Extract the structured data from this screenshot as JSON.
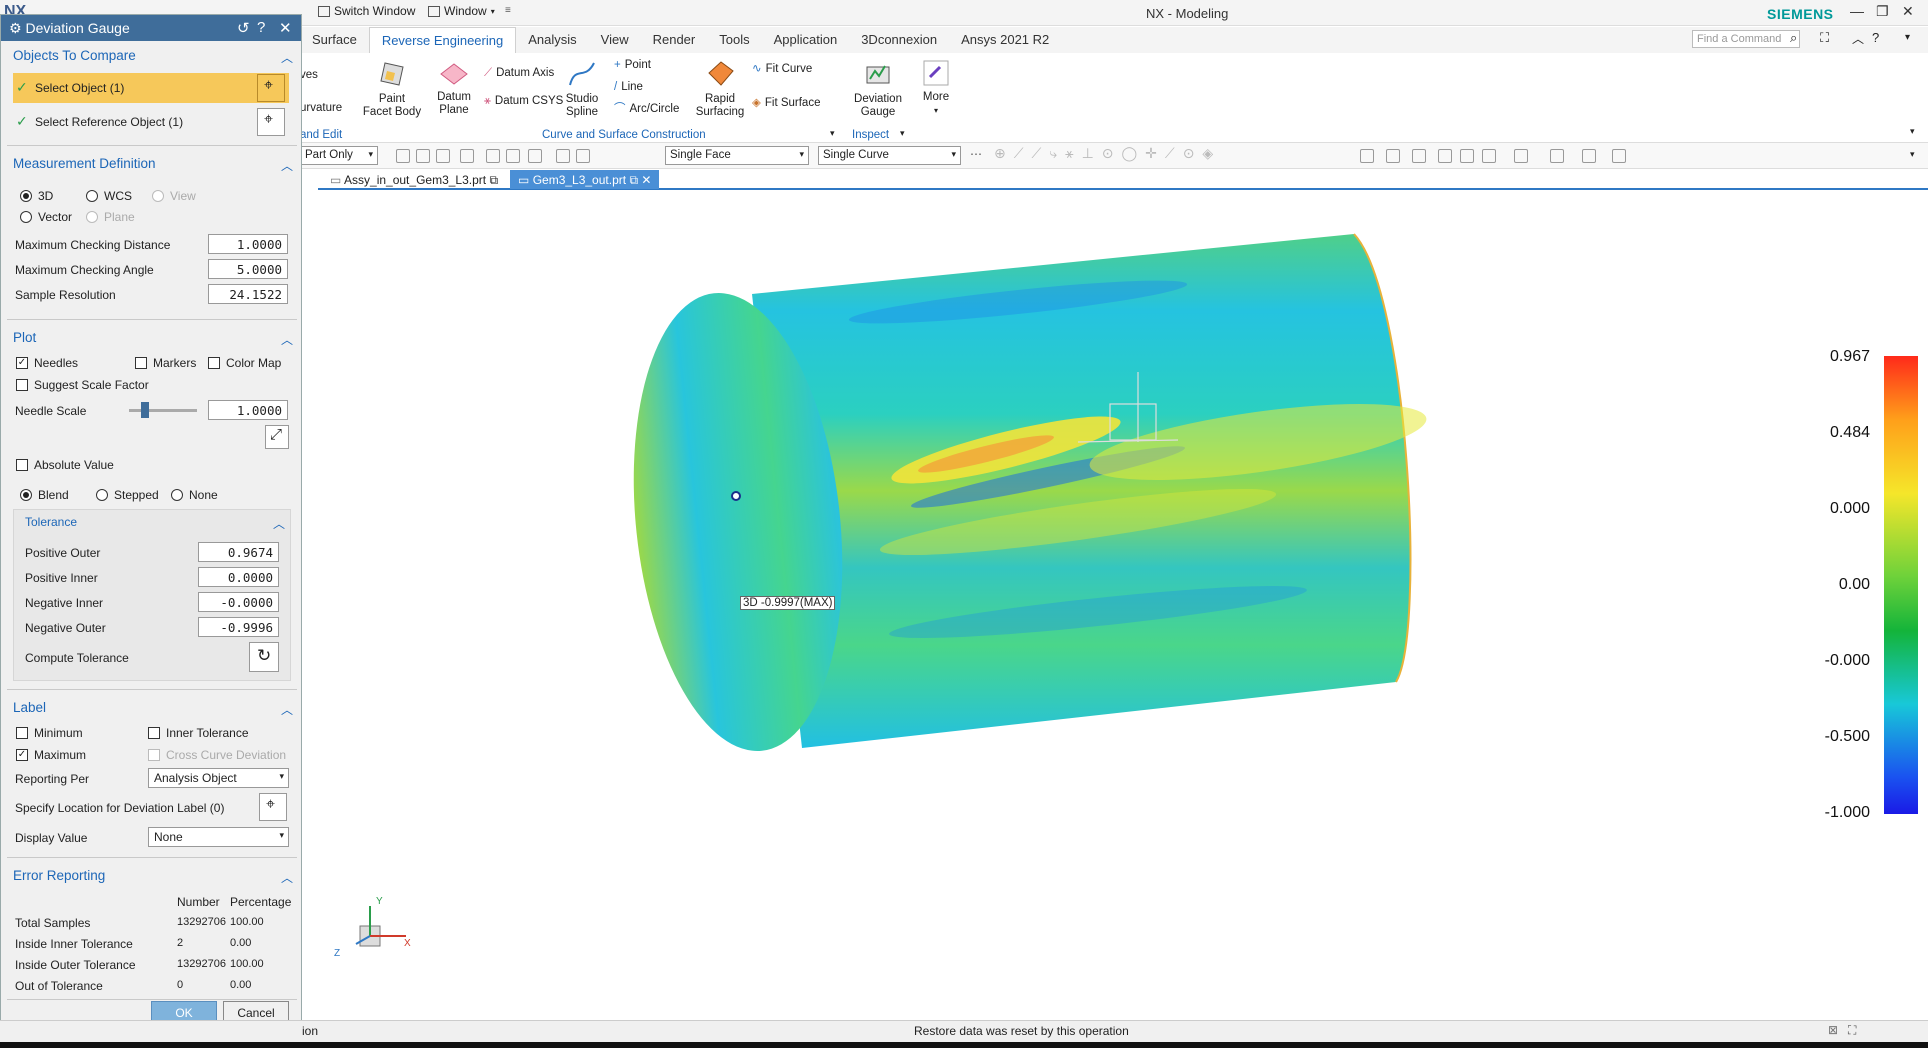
{
  "titlebar": {
    "logo": "NX",
    "switch_window": "Switch Window",
    "window": "Window",
    "app_title": "NX - Modeling",
    "brand": "SIEMENS"
  },
  "ribbon": {
    "tabs": [
      "Surface",
      "Reverse Engineering",
      "Analysis",
      "View",
      "Render",
      "Tools",
      "Application",
      "3Dconnexion",
      "Ansys 2021 R2"
    ],
    "search_placeholder": "Find a Command",
    "cut_items": [
      "ves",
      "urvature",
      "and Edit"
    ],
    "paint_facet_body": "Paint\nFacet Body",
    "datum_plane": "Datum\nPlane",
    "datum_axis": "Datum Axis",
    "datum_csys": "Datum CSYS",
    "studio_spline": "Studio\nSpline",
    "point": "Point",
    "line": "Line",
    "arc_circle": "Arc/Circle",
    "rapid_surfacing": "Rapid\nSurfacing",
    "fit_curve": "Fit Curve",
    "fit_surface": "Fit Surface",
    "group_curve": "Curve and Surface Construction",
    "deviation_gauge": "Deviation\nGauge",
    "group_inspect": "Inspect",
    "more": "More"
  },
  "toolbar": {
    "filter": "Part Only",
    "face_rule": "Single Face",
    "curve_rule": "Single Curve"
  },
  "doctabs": [
    {
      "label": "Assy_in_out_Gem3_L3.prt"
    },
    {
      "label": "Gem3_L3_out.prt"
    }
  ],
  "graphics": {
    "deviation_label": "3D -0.9997(MAX)",
    "colors": {
      "cylinder": "#27c6d6",
      "accent": "#2f78c4"
    },
    "colorbar_labels": [
      "0.967",
      "0.484",
      "0.000",
      "0.00",
      "-0.000",
      "-0.500",
      "-1.000"
    ],
    "triad": {
      "x": "X",
      "y": "Y",
      "z": "Z"
    }
  },
  "dialog": {
    "title": "Deviation Gauge",
    "objects_to_compare": "Objects To Compare",
    "select_object": "Select Object (1)",
    "select_reference": "Select Reference Object (1)",
    "measurement_definition": "Measurement Definition",
    "opt_3d": "3D",
    "opt_wcs": "WCS",
    "opt_view": "View",
    "opt_vector": "Vector",
    "opt_plane": "Plane",
    "max_check_dist_label": "Maximum Checking Distance",
    "max_check_dist": "1.0000",
    "max_check_angle_label": "Maximum Checking Angle",
    "max_check_angle": "5.0000",
    "sample_res_label": "Sample Resolution",
    "sample_res": "24.1522",
    "plot": "Plot",
    "needles": "Needles",
    "markers": "Markers",
    "color_map": "Color Map",
    "suggest_scale": "Suggest Scale Factor",
    "needle_scale_label": "Needle Scale",
    "needle_scale": "1.0000",
    "absolute_value": "Absolute Value",
    "blend": "Blend",
    "stepped": "Stepped",
    "none": "None",
    "tolerance": "Tolerance",
    "pos_outer_label": "Positive Outer",
    "pos_outer": "0.9674",
    "pos_inner_label": "Positive Inner",
    "pos_inner": "0.0000",
    "neg_inner_label": "Negative Inner",
    "neg_inner": "-0.0000",
    "neg_outer_label": "Negative Outer",
    "neg_outer": "-0.9996",
    "compute_tol": "Compute Tolerance",
    "label": "Label",
    "minimum": "Minimum",
    "inner_tol": "Inner Tolerance",
    "maximum": "Maximum",
    "cross_curve": "Cross Curve Deviation",
    "reporting_per_label": "Reporting Per",
    "reporting_per": "Analysis Object",
    "specify_location": "Specify Location for Deviation Label (0)",
    "display_value_label": "Display Value",
    "display_value": "None",
    "error_reporting": "Error Reporting",
    "col_number": "Number",
    "col_percentage": "Percentage",
    "rows": [
      {
        "label": "Total Samples",
        "number": "13292706",
        "pct": "100.00"
      },
      {
        "label": "Inside Inner Tolerance",
        "number": "2",
        "pct": "0.00"
      },
      {
        "label": "Inside Outer Tolerance",
        "number": "13292706",
        "pct": "100.00"
      },
      {
        "label": "Out of Tolerance",
        "number": "0",
        "pct": "0.00"
      }
    ],
    "ok": "OK",
    "cancel": "Cancel"
  },
  "status": {
    "left": "ion",
    "message": "Restore data was reset by this operation"
  }
}
